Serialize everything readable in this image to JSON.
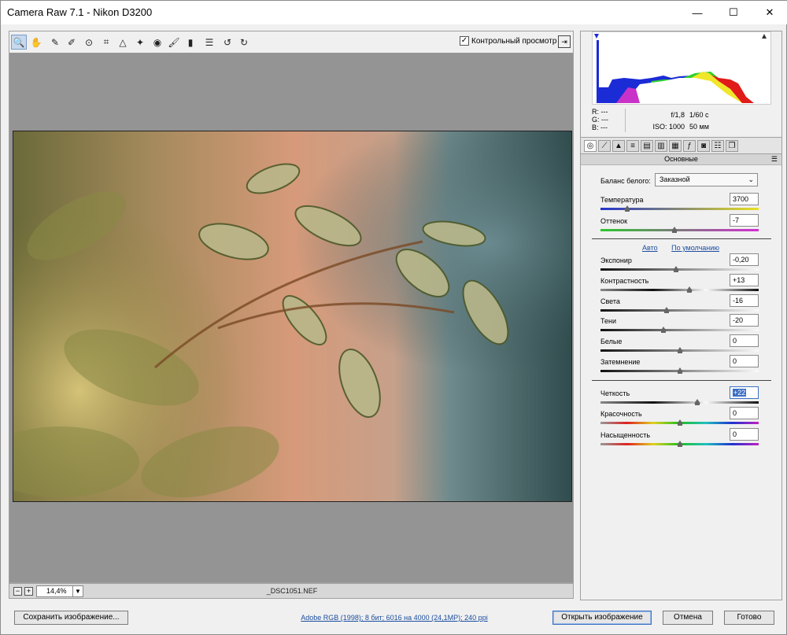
{
  "window": {
    "title": "Camera Raw 7.1  -  Nikon D3200",
    "controls": {
      "minimize": "—",
      "maximize": "☐",
      "close": "✕"
    }
  },
  "toolbar": {
    "tools": [
      "zoom-icon",
      "hand-icon",
      "white-balance-icon",
      "color-sampler-icon",
      "target-adjust-icon",
      "crop-icon",
      "straighten-icon",
      "spot-removal-icon",
      "red-eye-icon",
      "adjustment-brush-icon",
      "graduated-filter-icon",
      "preferences-icon",
      "rotate-left-icon",
      "rotate-right-icon"
    ],
    "preview_label": "Контрольный просмотр",
    "preview_checked": true
  },
  "status": {
    "zoom": "14,4%",
    "filename": "_DSC1051.NEF"
  },
  "info": {
    "r_label": "R:",
    "g_label": "G:",
    "b_label": "B:",
    "r": "---",
    "g": "---",
    "b": "---",
    "aperture": "f/1,8",
    "shutter": "1/60 с",
    "iso": "ISO: 1000",
    "focal": "50 мм"
  },
  "panel": {
    "section_title": "Основные",
    "wb_label": "Баланс белого:",
    "wb_value": "Заказной",
    "auto_link": "Авто",
    "default_link": "По умолчанию",
    "temperature": {
      "label": "Температура",
      "value": "3700",
      "fraction": 0.17
    },
    "tint": {
      "label": "Оттенок",
      "value": "-7",
      "fraction": 0.47
    },
    "exposure": {
      "label": "Экспонир",
      "value": "-0,20",
      "fraction": 0.48
    },
    "contrast": {
      "label": "Контрастность",
      "value": "+13",
      "fraction": 0.56
    },
    "highlights": {
      "label": "Света",
      "value": "-16",
      "fraction": 0.42
    },
    "shadows": {
      "label": "Тени",
      "value": "-20",
      "fraction": 0.4
    },
    "whites": {
      "label": "Белые",
      "value": "0",
      "fraction": 0.5
    },
    "blacks": {
      "label": "Затемнение",
      "value": "0",
      "fraction": 0.5
    },
    "clarity": {
      "label": "Четкость",
      "value": "+22",
      "fraction": 0.61
    },
    "vibrance": {
      "label": "Красочность",
      "value": "0",
      "fraction": 0.5
    },
    "saturation": {
      "label": "Насыщенность",
      "value": "0",
      "fraction": 0.5
    }
  },
  "footer": {
    "save_label": "Сохранить изображение...",
    "workflow_link": "Adobe RGB (1998); 8 бит; 6016 на 4000 (24,1MP); 240 ppi",
    "open_label": "Открыть изображение",
    "cancel_label": "Отмена",
    "done_label": "Готово"
  }
}
